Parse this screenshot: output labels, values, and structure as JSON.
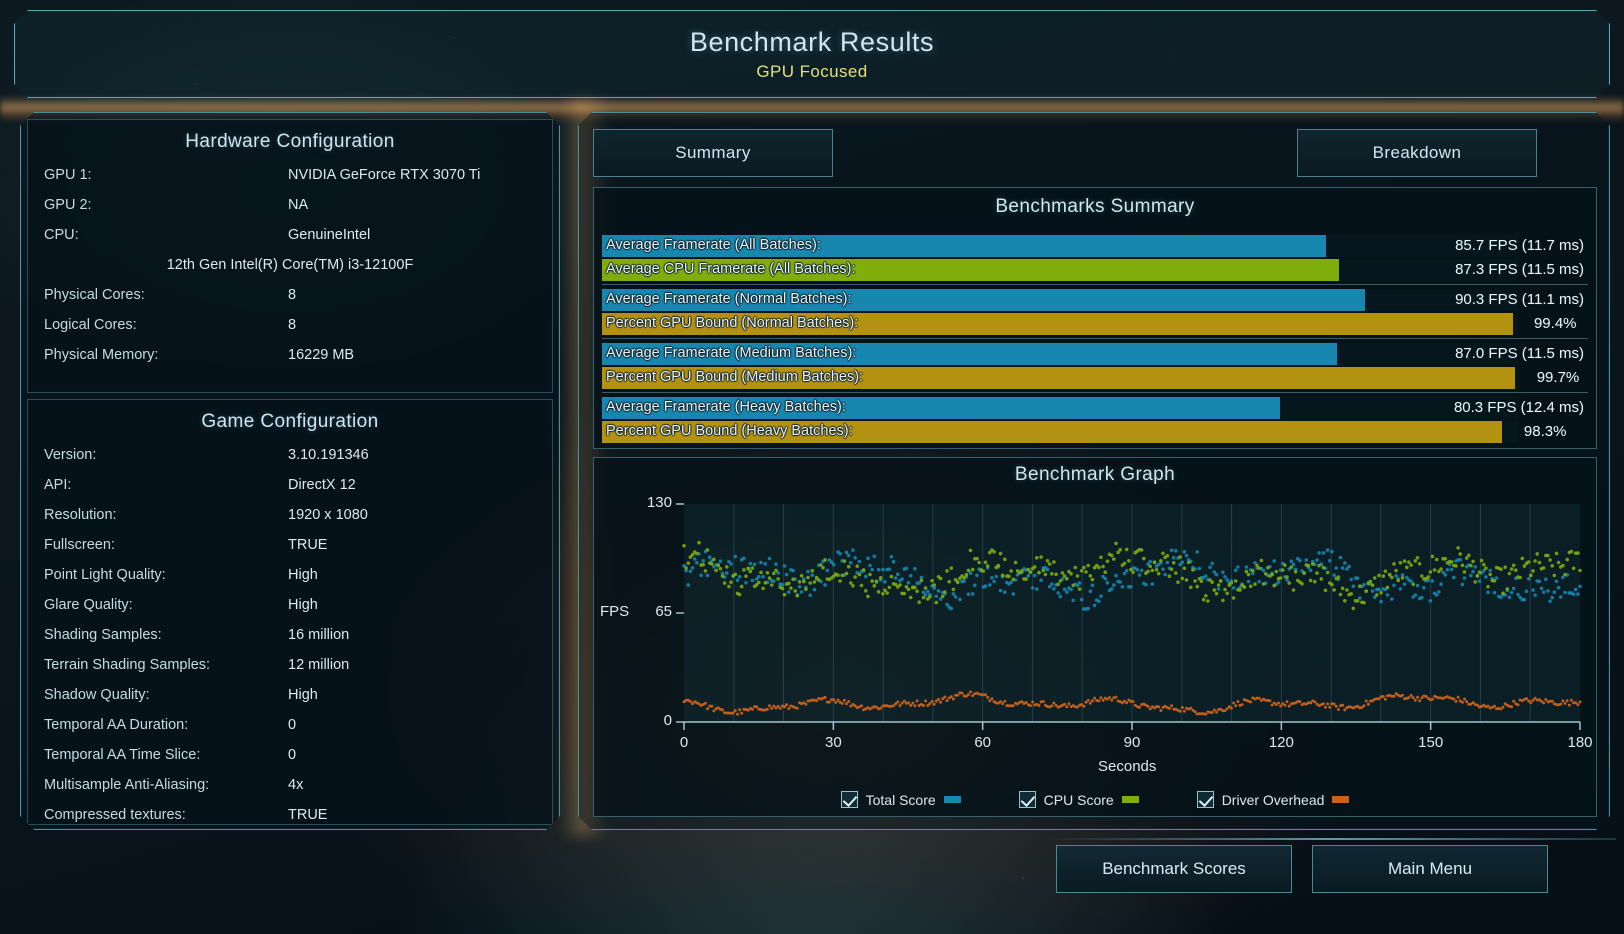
{
  "header": {
    "title": "Benchmark Results",
    "subtitle": "GPU Focused"
  },
  "tabs": {
    "summary": "Summary",
    "breakdown": "Breakdown"
  },
  "hardware": {
    "title": "Hardware Configuration",
    "rows": [
      {
        "key": "GPU 1:",
        "value": "NVIDIA GeForce RTX 3070 Ti"
      },
      {
        "key": "GPU 2:",
        "value": "NA"
      },
      {
        "key": "CPU:",
        "value": "GenuineIntel"
      },
      {
        "key": "",
        "value": "12th Gen Intel(R) Core(TM) i3-12100F"
      },
      {
        "key": "Physical Cores:",
        "value": "8"
      },
      {
        "key": "Logical Cores:",
        "value": "8"
      },
      {
        "key": "Physical Memory:",
        "value": "16229  MB"
      }
    ]
  },
  "game": {
    "title": "Game Configuration",
    "rows": [
      {
        "key": "Version:",
        "value": "3.10.191346"
      },
      {
        "key": "API:",
        "value": "DirectX 12"
      },
      {
        "key": "Resolution:",
        "value": "1920 x 1080"
      },
      {
        "key": "Fullscreen:",
        "value": "TRUE"
      },
      {
        "key": "Point Light Quality:",
        "value": "High"
      },
      {
        "key": "Glare Quality:",
        "value": "High"
      },
      {
        "key": "Shading Samples:",
        "value": "16 million"
      },
      {
        "key": "Terrain Shading Samples:",
        "value": "12 million"
      },
      {
        "key": "Shadow Quality:",
        "value": "High"
      },
      {
        "key": "Temporal AA Duration:",
        "value": "0"
      },
      {
        "key": "Temporal AA Time Slice:",
        "value": "0"
      },
      {
        "key": "Multisample Anti-Aliasing:",
        "value": "4x"
      },
      {
        "key": "Compressed textures:",
        "value": "TRUE"
      }
    ]
  },
  "summary": {
    "title": "Benchmarks Summary",
    "colors": {
      "fps": "#1787b0",
      "cpu": "#7fae0c",
      "pct": "#b39212"
    },
    "rows": [
      {
        "label": "Average Framerate (All Batches):",
        "value": "85.7 FPS (11.7 ms)",
        "pct": 79.0,
        "kind": "fps"
      },
      {
        "label": "Average CPU Framerate (All Batches):",
        "value": "87.3 FPS (11.5 ms)",
        "pct": 80.5,
        "kind": "cpu"
      },
      {
        "label": "Average Framerate (Normal Batches):",
        "value": "90.3 FPS (11.1 ms)",
        "pct": 83.3,
        "kind": "fps"
      },
      {
        "label": "Percent GPU Bound (Normal Batches):",
        "value": "99.4%",
        "pct": 99.4,
        "kind": "pct"
      },
      {
        "label": "Average Framerate (Medium Batches):",
        "value": "87.0 FPS (11.5 ms)",
        "pct": 80.2,
        "kind": "fps"
      },
      {
        "label": "Percent GPU Bound (Medium Batches):",
        "value": "99.7%",
        "pct": 99.7,
        "kind": "pct"
      },
      {
        "label": "Average Framerate (Heavy Batches):",
        "value": "80.3 FPS (12.4 ms)",
        "pct": 74.0,
        "kind": "fps"
      },
      {
        "label": "Percent GPU Bound (Heavy Batches):",
        "value": "98.3%",
        "pct": 98.3,
        "kind": "pct"
      }
    ]
  },
  "graph": {
    "title": "Benchmark Graph",
    "legend": [
      {
        "label": "Total Score",
        "color": "#1787b0",
        "checked": true
      },
      {
        "label": "CPU Score",
        "color": "#7fae0c",
        "checked": true
      },
      {
        "label": "Driver Overhead",
        "color": "#c9621a",
        "checked": true
      }
    ]
  },
  "chart_data": {
    "type": "scatter",
    "title": "Benchmark Graph",
    "xlabel": "Seconds",
    "ylabel": "FPS",
    "xlim": [
      0,
      180
    ],
    "ylim": [
      0,
      130
    ],
    "xticks": [
      "0",
      "30",
      "60",
      "90",
      "120",
      "150",
      "180"
    ],
    "yticks": [
      "0",
      "65",
      "130"
    ],
    "grid": "vertical",
    "legend_position": "bottom",
    "series": [
      {
        "name": "Total Score",
        "color": "#1787b0",
        "mean": 86,
        "min": 62,
        "max": 121,
        "n_points": 420
      },
      {
        "name": "CPU Score",
        "color": "#7fae0c",
        "mean": 88,
        "min": 64,
        "max": 126,
        "n_points": 420
      },
      {
        "name": "Driver Overhead",
        "color": "#c9621a",
        "mean": 11,
        "min": 4,
        "max": 19,
        "n_points": 420
      }
    ]
  },
  "footer": {
    "scores": "Benchmark Scores",
    "main_menu": "Main Menu"
  }
}
